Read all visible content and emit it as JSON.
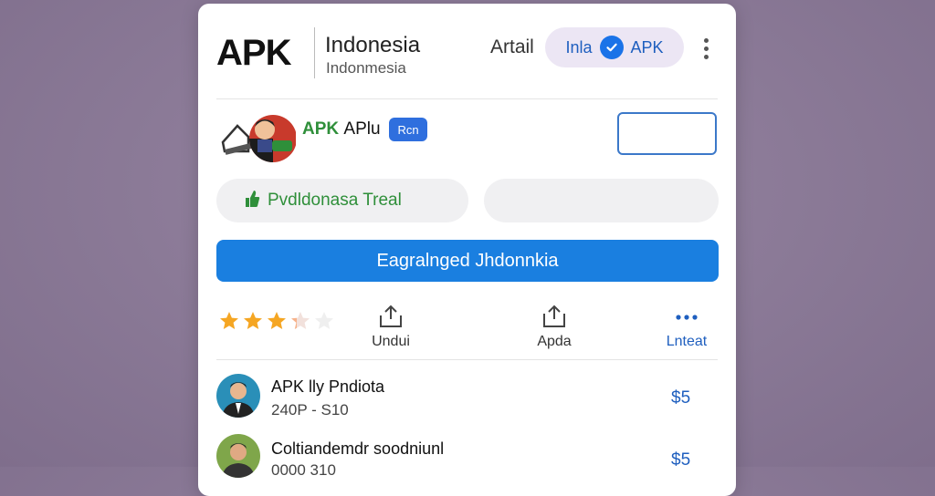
{
  "header": {
    "logo": "APK",
    "title": "Indonesia",
    "subtitle": "Indonmesia",
    "link_label": "Artail",
    "chip": {
      "left": "Inla",
      "right": "APK"
    }
  },
  "app": {
    "name_green": "APK",
    "name_rest": "APlu",
    "badge": "Rcn"
  },
  "pill_left_label": "Pvdldonasa Treal",
  "cta_label": "Eagralnged Jhdonnkia",
  "rating": {
    "filled": 3,
    "partial": 0.3,
    "total": 5
  },
  "actions": [
    {
      "label": "Undui",
      "icon": "share-icon"
    },
    {
      "label": "Apda",
      "icon": "upload-icon"
    },
    {
      "label": "Lnteat",
      "icon": "more-horizontal-icon"
    }
  ],
  "list": [
    {
      "title": "APK lly Pndiota",
      "subtitle": "240P - S10",
      "price": "$5"
    },
    {
      "title": "Coltiandemdr soodniunl",
      "subtitle": "0000 310",
      "price": "$5"
    }
  ],
  "colors": {
    "accent": "#1a7fe0",
    "green": "#2f8f3a",
    "chip_bg": "#ece6f4",
    "background": "#8c7b98"
  }
}
